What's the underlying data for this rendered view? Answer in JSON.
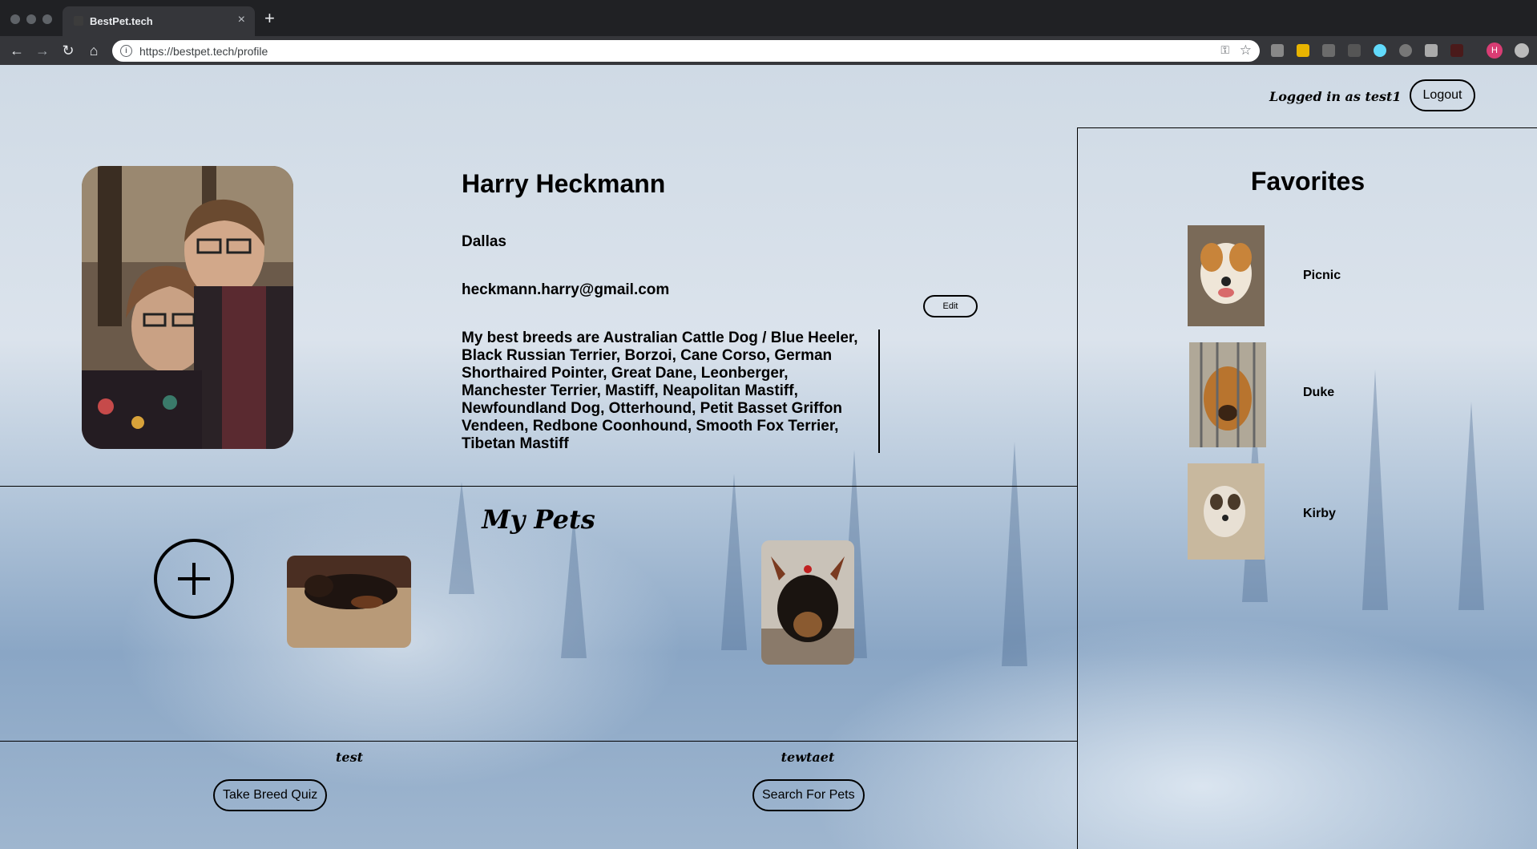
{
  "browser": {
    "tab_title": "BestPet.tech",
    "tab_close": "×",
    "new_tab": "+",
    "url": "https://bestpet.tech/profile",
    "profile_initial": "H"
  },
  "header": {
    "logged_in_text": "Logged in as test1",
    "logout_label": "Logout"
  },
  "profile": {
    "name": "Harry Heckmann",
    "city": "Dallas",
    "email": "heckmann.harry@gmail.com",
    "bio": "My best breeds are Australian Cattle Dog / Blue Heeler, Black Russian Terrier, Borzoi, Cane Corso, German Shorthaired Pointer, Great Dane, Leonberger, Manchester Terrier, Mastiff, Neapolitan Mastiff, Newfoundland Dog, Otterhound, Petit Basset Griffon Vendeen, Redbone Coonhound, Smooth Fox Terrier, Tibetan Mastiff",
    "edit_label": "Edit"
  },
  "favorites": {
    "title": "Favorites",
    "items": [
      {
        "name": "Picnic"
      },
      {
        "name": "Duke"
      },
      {
        "name": "Kirby"
      }
    ]
  },
  "my_pets": {
    "title": "My Pets",
    "add_icon": "plus-circle-icon",
    "pets": [
      {
        "name": "test"
      },
      {
        "name": "tewtaet"
      }
    ]
  },
  "actions": {
    "quiz_label": "Take Breed Quiz",
    "search_label": "Search For Pets"
  }
}
